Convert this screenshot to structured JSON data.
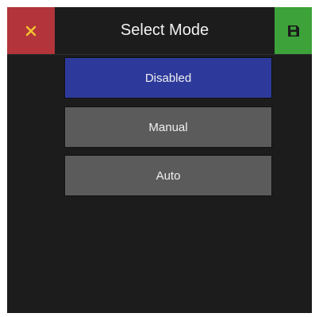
{
  "header": {
    "title": "Select Mode",
    "close_icon": "close-icon",
    "save_icon": "floppy-disk-icon"
  },
  "options": [
    {
      "label": "Disabled",
      "selected": true
    },
    {
      "label": "Manual",
      "selected": false
    },
    {
      "label": "Auto",
      "selected": false
    }
  ],
  "colors": {
    "close": "#b3353b",
    "save": "#3da23a",
    "selected": "#2d3a9b",
    "option": "#5b5b5b",
    "background": "#1c1c1c",
    "close_icon": "#f4c430"
  }
}
